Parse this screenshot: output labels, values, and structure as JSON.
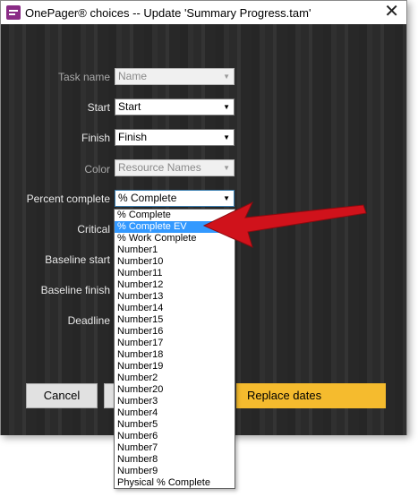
{
  "window": {
    "title": "OnePager® choices -- Update 'Summary Progress.tam'",
    "close_glyph": "✕"
  },
  "fields": {
    "task_name": {
      "label": "Task name",
      "value": "Name"
    },
    "start": {
      "label": "Start",
      "value": "Start"
    },
    "finish": {
      "label": "Finish",
      "value": "Finish"
    },
    "color": {
      "label": "Color",
      "value": "Resource Names"
    },
    "percent_complete": {
      "label": "Percent complete",
      "value": "% Complete"
    },
    "critical": {
      "label": "Critical"
    },
    "baseline_start": {
      "label": "Baseline start"
    },
    "baseline_finish": {
      "label": "Baseline finish"
    },
    "deadline": {
      "label": "Deadline"
    }
  },
  "buttons": {
    "cancel": "Cancel",
    "replace_dates": "Replace dates"
  },
  "dropdown": {
    "selected_index": 1,
    "options": [
      "% Complete",
      "% Complete EV",
      "% Work Complete",
      "Number1",
      "Number10",
      "Number11",
      "Number12",
      "Number13",
      "Number14",
      "Number15",
      "Number16",
      "Number17",
      "Number18",
      "Number19",
      "Number2",
      "Number20",
      "Number3",
      "Number4",
      "Number5",
      "Number6",
      "Number7",
      "Number8",
      "Number9",
      "Physical % Complete"
    ]
  },
  "colors": {
    "accent_button": "#f5bb2e",
    "selection": "#3399ff",
    "annotation_arrow": "#d0121b",
    "app_icon": "#8a2c86"
  },
  "icons": {
    "app": "onepager-logo-icon",
    "dropdown_arrow": "chevron-down-icon",
    "annotation": "red-arrow-icon"
  }
}
